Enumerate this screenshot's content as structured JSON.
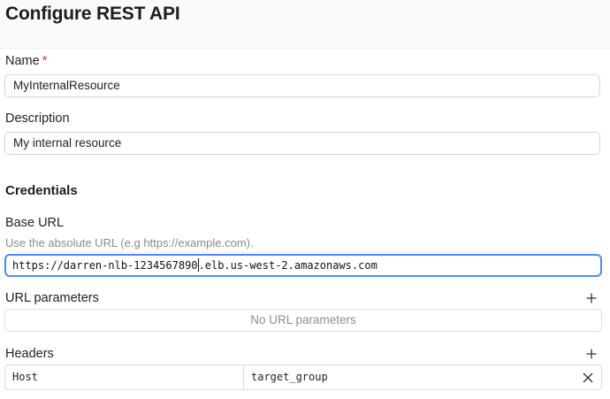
{
  "page": {
    "title": "Configure REST API"
  },
  "name": {
    "label": "Name",
    "required_mark": "*",
    "value": "MyInternalResource"
  },
  "description": {
    "label": "Description",
    "value": "My internal resource"
  },
  "credentials": {
    "heading": "Credentials"
  },
  "base_url": {
    "label": "Base URL",
    "hint": "Use the absolute URL (e.g https://example.com).",
    "value_before_cursor": "https://darren-nlb-1234567890",
    "value_after_cursor": ".elb.us-west-2.amazonaws.com",
    "focus_color": "#4a8cf3"
  },
  "url_parameters": {
    "label": "URL parameters",
    "empty_text": "No URL parameters",
    "add_icon": "plus-icon"
  },
  "headers": {
    "label": "Headers",
    "add_icon": "plus-icon",
    "rows": [
      {
        "key": "Host",
        "value": "target_group",
        "remove_icon": "close-icon"
      }
    ]
  }
}
